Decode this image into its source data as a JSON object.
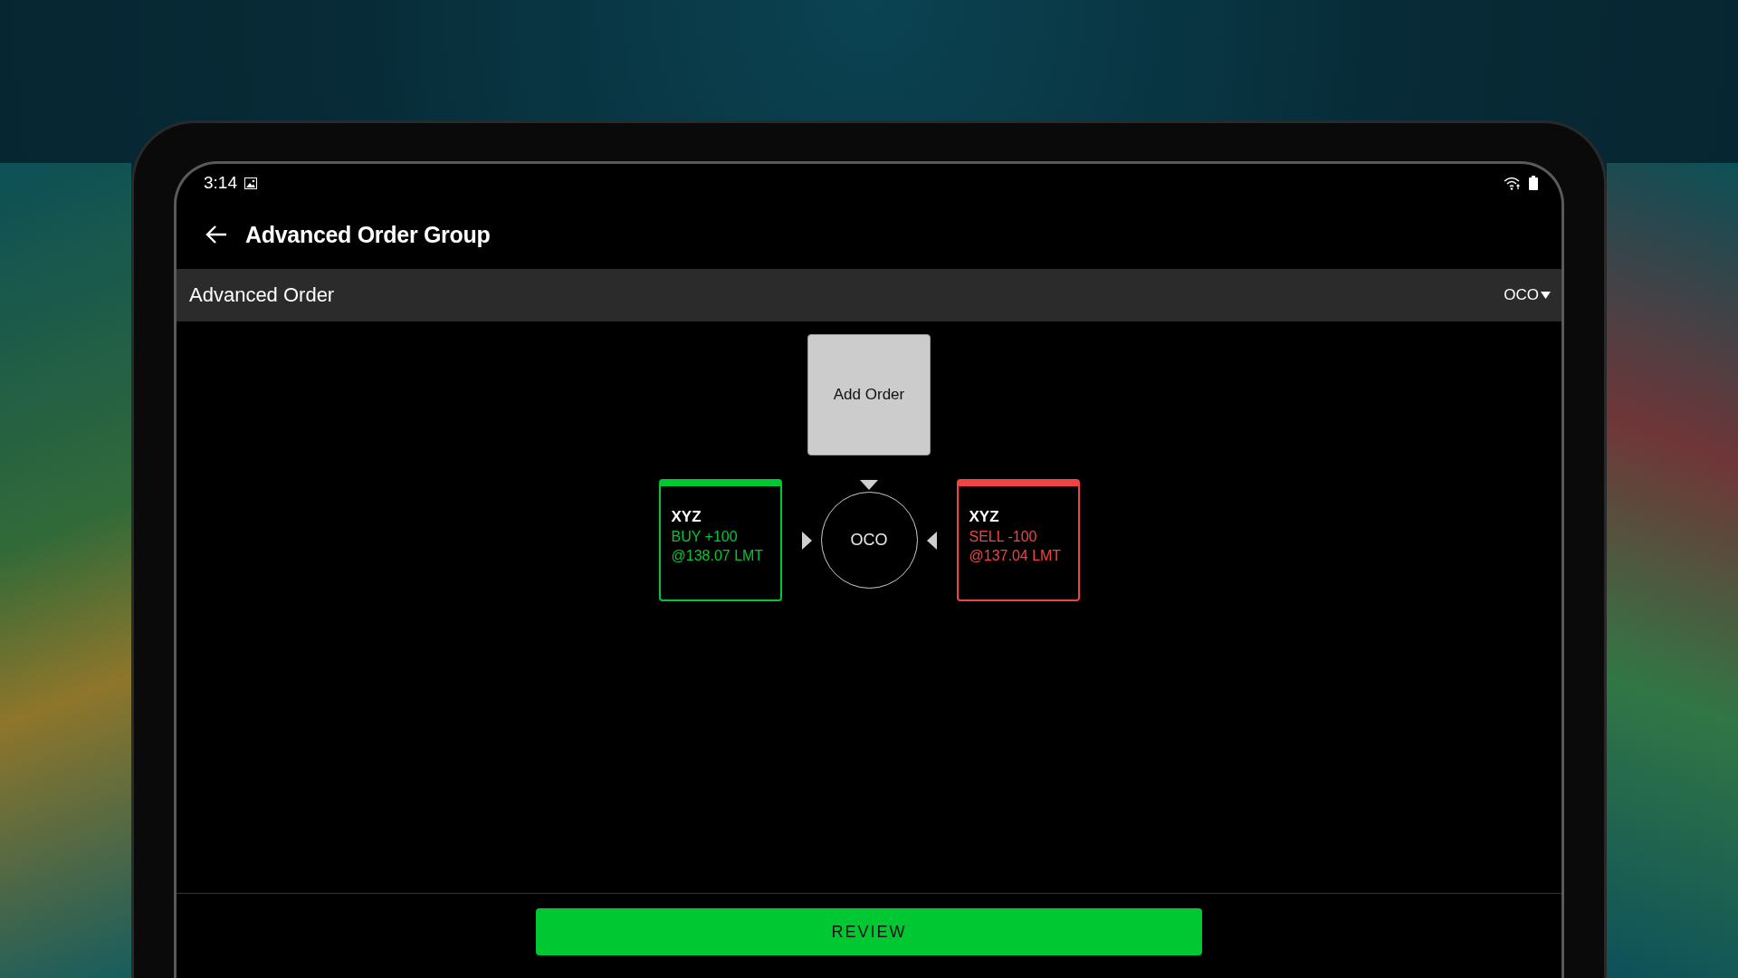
{
  "status_bar": {
    "time": "3:14"
  },
  "header": {
    "title": "Advanced Order Group"
  },
  "section": {
    "label": "Advanced Order",
    "type_selector": "OCO"
  },
  "add_order": {
    "label": "Add Order"
  },
  "group": {
    "label": "OCO"
  },
  "orders": [
    {
      "kind": "buy",
      "symbol": "XYZ",
      "action": "BUY +100",
      "price": "@138.07 LMT"
    },
    {
      "kind": "sell",
      "symbol": "XYZ",
      "action": "SELL -100",
      "price": "@137.04 LMT"
    }
  ],
  "review_button": {
    "label": "REVIEW"
  }
}
